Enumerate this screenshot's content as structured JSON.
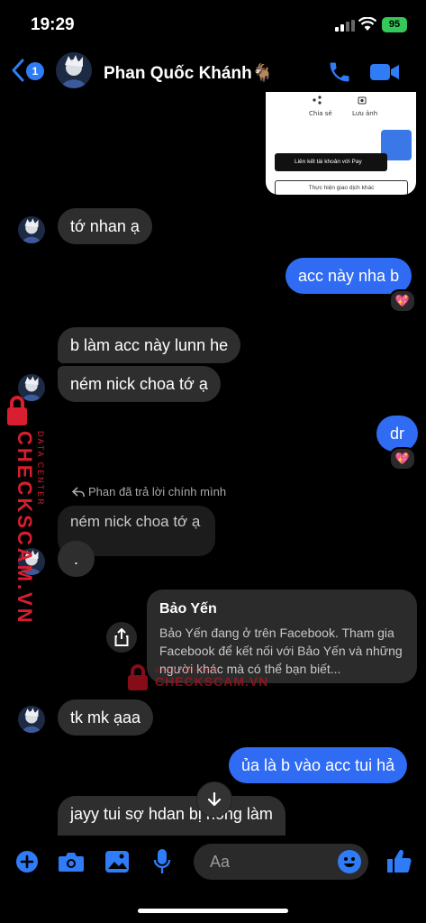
{
  "status_bar": {
    "time": "19:29",
    "battery": "95"
  },
  "header": {
    "back_badge": "1",
    "contact_name": "Phan Quốc Khánh🐐"
  },
  "shared_image": {
    "share_label": "Chia sẻ",
    "save_label": "Lưu ảnh",
    "link_button": "Liên kết tài khoản với  Pay",
    "other_button": "Thực hiện giao dịch khác"
  },
  "messages": {
    "m1": "tớ nhan ạ",
    "m2": "acc này nha b",
    "m3": "b làm acc này lunn he",
    "m4": "ném nick choa tớ ạ",
    "m5": "dr",
    "reply_note": "Phan đã trả lời chính mình",
    "reply_quote": "ném nick choa tớ ạ",
    "reply_body": ".",
    "m6": "tk mk ạaa",
    "m7": "ủa là b vào acc tui hả",
    "m8": "jayy tui sợ hdan bị hong làm"
  },
  "link_card": {
    "title": "Bảo Yến",
    "description": "Bảo Yến đang ở trên Facebook. Tham gia Facebook để kết nối với Bảo Yến và những người khác mà có thể bạn biết..."
  },
  "reaction_icon": "sparkling-heart",
  "composer": {
    "placeholder": "Aa"
  },
  "watermark": {
    "top": "DATA CENTER",
    "main": "CHECKSCAM.VN"
  },
  "colors": {
    "accent": "#2f6cf3",
    "incoming": "#2e2e2e",
    "watermark": "#d91e2f"
  }
}
